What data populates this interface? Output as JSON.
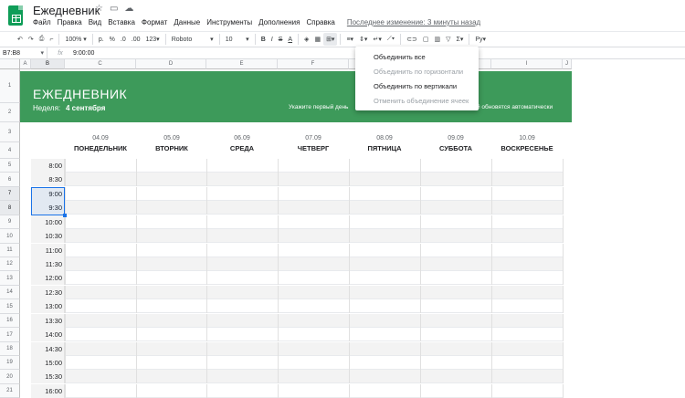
{
  "app": {
    "title": "Ежедневник",
    "title_icons": [
      "☆",
      "▭",
      "☁"
    ]
  },
  "menu": [
    "Файл",
    "Правка",
    "Вид",
    "Вставка",
    "Формат",
    "Данные",
    "Инструменты",
    "Дополнения",
    "Справка"
  ],
  "last_edit": "Последнее изменение: 3 минуты назад",
  "toolbar": {
    "zoom": "100%",
    "currency": "р.",
    "percent": "%",
    "dec_less": ".0",
    "dec_more": ".00",
    "format_more": "123",
    "font": "Roboto",
    "font_size": "10",
    "bold": "B",
    "italic": "I",
    "strike": "S",
    "text_color": "A"
  },
  "formula_bar": {
    "cell_ref": "B7:B8",
    "fx": "fx",
    "value": "9:00:00"
  },
  "columns": [
    "A",
    "B",
    "C",
    "D",
    "E",
    "F",
    "G",
    "H",
    "I",
    "J"
  ],
  "rows": [
    "1",
    "2",
    "3",
    "4",
    "5",
    "6",
    "7",
    "8",
    "9",
    "10",
    "11",
    "12",
    "13",
    "14",
    "15",
    "16",
    "17",
    "18",
    "19",
    "20",
    "21"
  ],
  "banner": {
    "title": "ЕЖЕДНЕВНИК",
    "week_label": "Неделя:",
    "week_value": "4 сентября",
    "note_left": "Укажите первый день",
    "note_right": "й обновятся автоматически"
  },
  "days": [
    {
      "date": "04.09",
      "name": "ПОНЕДЕЛЬНИК"
    },
    {
      "date": "05.09",
      "name": "ВТОРНИК"
    },
    {
      "date": "06.09",
      "name": "СРЕДА"
    },
    {
      "date": "07.09",
      "name": "ЧЕТВЕРГ"
    },
    {
      "date": "08.09",
      "name": "ПЯТНИЦА"
    },
    {
      "date": "09.09",
      "name": "СУББОТА"
    },
    {
      "date": "10.09",
      "name": "ВОСКРЕСЕНЬЕ"
    }
  ],
  "times": [
    "8:00",
    "8:30",
    "9:00",
    "9:30",
    "10:00",
    "10:30",
    "11:00",
    "11:30",
    "12:00",
    "12:30",
    "13:00",
    "13:30",
    "14:00",
    "14:30",
    "15:00",
    "15:30",
    "16:00"
  ],
  "merge_menu": [
    {
      "label": "Объединить все",
      "enabled": true
    },
    {
      "label": "Объединить по горизонтали",
      "enabled": false
    },
    {
      "label": "Объединить по вертикали",
      "enabled": true
    },
    {
      "label": "Отменить объединение ячеек",
      "enabled": false
    }
  ],
  "colors": {
    "accent_green": "#3d9a5a",
    "selection_blue": "#1a73e8"
  }
}
